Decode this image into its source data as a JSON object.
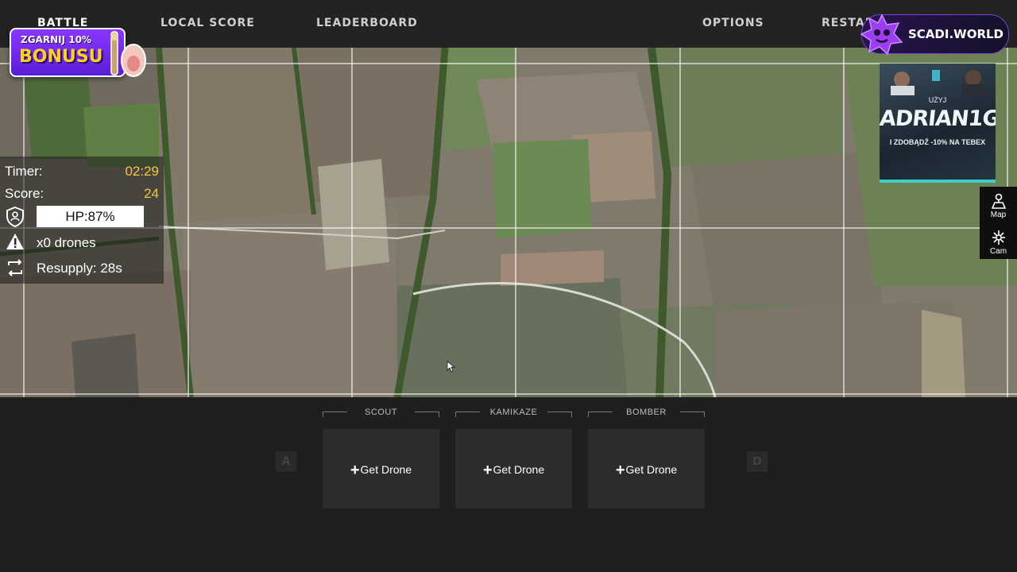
{
  "nav": {
    "battle": "BATTLE",
    "local_score": "LOCAL SCORE",
    "leaderboard": "LEADERBOARD",
    "options": "OPTIONS",
    "restart": "RESTART"
  },
  "bonus": {
    "line1": "ZGARNIJ 10%",
    "line2": "BONUSU"
  },
  "scadi": {
    "name": "SCADI.WORLD"
  },
  "hud": {
    "timer_label": "Timer:",
    "timer_value": "02:29",
    "score_label": "Score:",
    "score_value": "24",
    "hp": "HP:87%",
    "drones": "x0 drones",
    "resupply": "Resupply: 28s"
  },
  "ad": {
    "pre": "UŻYJ",
    "code": "ADRIAN1G",
    "sub": "I ZDOBĄDŹ -10% NA TEBEX"
  },
  "tools": {
    "map": "Map",
    "cam": "Cam"
  },
  "keys": {
    "left": "A",
    "right": "D"
  },
  "drones": [
    {
      "type": "SCOUT",
      "action": "Get Drone"
    },
    {
      "type": "KAMIKAZE",
      "action": "Get Drone"
    },
    {
      "type": "BOMBER",
      "action": "Get Drone"
    }
  ],
  "colors": {
    "hud_value": "#f4c542",
    "accent_purple": "#8a37ff",
    "ad_accent": "#39d0c5"
  },
  "icons": [
    "shield-user-icon",
    "warning-icon",
    "resupply-icon",
    "map-icon",
    "cam-icon",
    "plus-icon"
  ]
}
